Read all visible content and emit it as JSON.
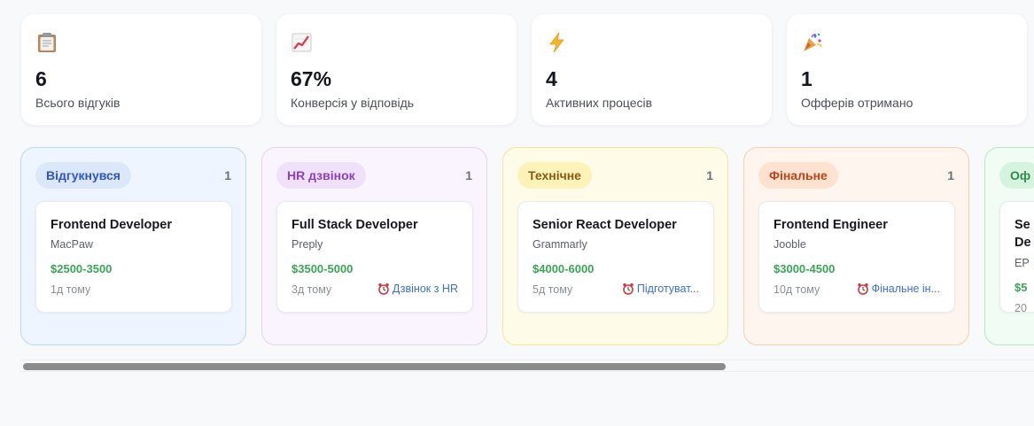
{
  "colors": {
    "stages": {
      "applied": {
        "bg": "#eef5fe",
        "border": "#bcd6f5",
        "pill_bg": "#dbe7fb",
        "pill_text": "#2f55c9"
      },
      "hr": {
        "bg": "#f9f4fe",
        "border": "#e3d2f6",
        "pill_bg": "#f0e1fb",
        "pill_text": "#8b3fc4"
      },
      "tech": {
        "bg": "#fefce9",
        "border": "#f5e69a",
        "pill_bg": "#fdf3b8",
        "pill_text": "#8a5a10"
      },
      "final": {
        "bg": "#fef5ee",
        "border": "#f5cfae",
        "pill_bg": "#fde2cf",
        "pill_text": "#c0431b"
      },
      "offer": {
        "bg": "#f0fcf4",
        "border": "#b7e7c5",
        "pill_bg": "#d6f3df",
        "pill_text": "#2e8b4a"
      }
    },
    "salary": "#3aa555",
    "task_link": "#3b6fd8"
  },
  "stats": [
    {
      "icon": "clipboard-icon",
      "value": "6",
      "label": "Всього відгуків"
    },
    {
      "icon": "chart-increasing-icon",
      "value": "67%",
      "label": "Конверсія у відповідь"
    },
    {
      "icon": "lightning-icon",
      "value": "4",
      "label": "Активних процесів"
    },
    {
      "icon": "party-popper-icon",
      "value": "1",
      "label": "Офферів отримано"
    }
  ],
  "columns": [
    {
      "stage": "Відгукнувся",
      "count": "1",
      "card": {
        "title": "Frontend Developer",
        "company": "MacPaw",
        "salary": "$2500-3500",
        "age": "1д тому",
        "task": ""
      }
    },
    {
      "stage": "HR дзвінок",
      "count": "1",
      "card": {
        "title": "Full Stack Developer",
        "company": "Preply",
        "salary": "$3500-5000",
        "age": "3д тому",
        "task": "Дзвінок з HR"
      }
    },
    {
      "stage": "Технічне",
      "count": "1",
      "card": {
        "title": "Senior React Developer",
        "company": "Grammarly",
        "salary": "$4000-6000",
        "age": "5д тому",
        "task": "Підготуват..."
      }
    },
    {
      "stage": "Фінальне",
      "count": "1",
      "card": {
        "title": "Frontend Engineer",
        "company": "Jooble",
        "salary": "$3000-4500",
        "age": "10д тому",
        "task": "Фінальне ін..."
      }
    },
    {
      "stage": "Оф",
      "count": "",
      "card": {
        "title_line1": "Se",
        "title_line2": "De",
        "company": "EP",
        "salary": "$5",
        "age": "20"
      }
    }
  ]
}
